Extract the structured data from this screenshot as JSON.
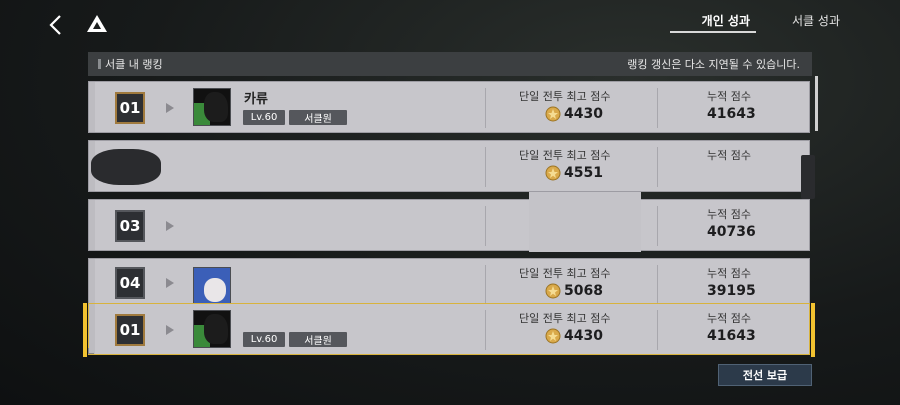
{
  "header": {
    "tabs": [
      {
        "label": "개인 성과",
        "active": true
      },
      {
        "label": "서클 성과",
        "active": false
      }
    ]
  },
  "panel": {
    "title": "서클 내 랭킹",
    "notice": "랭킹 갱신은 다소 지연될 수 있습니다."
  },
  "columns": {
    "best_label": "단일 전투 최고 점수",
    "total_label": "누적 점수"
  },
  "rows": [
    {
      "rank": "01",
      "name": "카류",
      "level": "Lv.60",
      "role": "서클원",
      "best": "4430",
      "total": "41643"
    },
    {
      "rank": "",
      "name": "",
      "level": "",
      "role": "",
      "best": "4551",
      "total": ""
    },
    {
      "rank": "03",
      "name": "",
      "level": "",
      "role": "",
      "best": "",
      "total": "40736"
    },
    {
      "rank": "04",
      "name": "",
      "level": "",
      "role": "",
      "best": "5068",
      "total": "39195"
    }
  ],
  "my_row": {
    "rank": "01",
    "name": "",
    "level": "Lv.60",
    "role": "서클원",
    "best": "4430",
    "total": "41643"
  },
  "footer": {
    "button_label": "전선 보급"
  },
  "colors": {
    "highlight": "#f2c230",
    "rank_gold": "#a07a3e"
  }
}
